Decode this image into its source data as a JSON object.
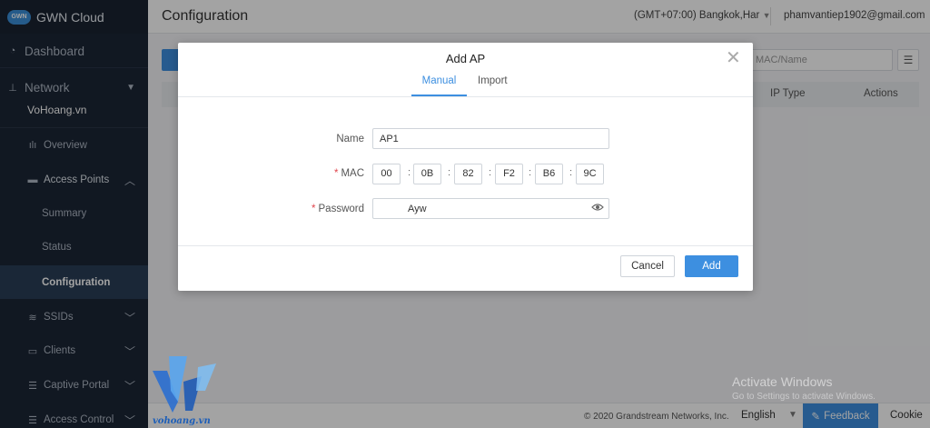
{
  "brand": {
    "name": "GWN Cloud",
    "logo_text": "GWN"
  },
  "sidebar": {
    "dashboard": "Dashboard",
    "network": "Network",
    "site": "VoHoang.vn",
    "overview": "Overview",
    "access_points": "Access Points",
    "summary": "Summary",
    "status": "Status",
    "configuration": "Configuration",
    "ssids": "SSIDs",
    "clients": "Clients",
    "captive_portal": "Captive Portal",
    "access_control": "Access Control"
  },
  "header": {
    "title": "Configuration",
    "timezone": "(GMT+07:00) Bangkok,Har",
    "email": "phamvantiep1902@gmail.com"
  },
  "toolbar": {
    "search_placeholder": "MAC/Name"
  },
  "table": {
    "columns": [
      "IP Type",
      "Actions"
    ]
  },
  "footer": {
    "copyright": "© 2020 Grandstream Networks, Inc.",
    "language": "English",
    "feedback": "Feedback",
    "cookie": "Cookie"
  },
  "windows_watermark": {
    "line1": "Activate Windows",
    "line2": "Go to Settings to activate Windows."
  },
  "watermark": {
    "site": "vohoang.vn"
  },
  "modal": {
    "title": "Add AP",
    "tabs": [
      "Manual",
      "Import"
    ],
    "name_label": "Name",
    "name_value": "AP1",
    "mac_label": "MAC",
    "mac_octets": [
      "00",
      "0B",
      "82",
      "F2",
      "B6",
      "9C"
    ],
    "password_label": "Password",
    "password_value": "Ayw",
    "required_mark": "*",
    "cancel": "Cancel",
    "add": "Add"
  },
  "colors": {
    "accent": "#3d8fe0",
    "sidebar_bg": "#1c2636",
    "required": "#e0464e"
  }
}
